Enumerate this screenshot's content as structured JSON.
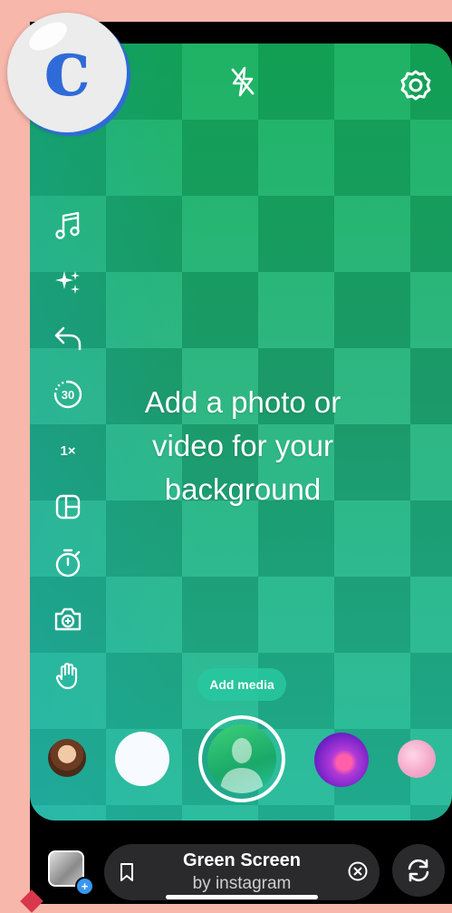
{
  "logo": {
    "letter": "c",
    "color": "#2f6bd8"
  },
  "top_bar": {
    "icons": [
      "flash-off-icon",
      "settings-gear-icon"
    ]
  },
  "left_tools": [
    {
      "name": "music-icon"
    },
    {
      "name": "effects-sparkle-icon"
    },
    {
      "name": "undo-icon"
    },
    {
      "name": "timer-duration-icon",
      "label": "30"
    },
    {
      "name": "speed-icon",
      "label": "1×"
    },
    {
      "name": "layout-icon"
    },
    {
      "name": "countdown-timer-icon"
    },
    {
      "name": "photo-booth-icon"
    },
    {
      "name": "hands-free-icon"
    }
  ],
  "center_text": {
    "line1": "Add a photo or",
    "line2": "video for your",
    "line3": "background"
  },
  "add_media_label": "Add media",
  "bottom": {
    "effect_name": "Green Screen",
    "effect_author": "by instagram",
    "gallery_plus": "+"
  },
  "colors": {
    "accent_blue": "#3897f0",
    "green": "#1fb27a",
    "pill": "#2a2a2c"
  }
}
